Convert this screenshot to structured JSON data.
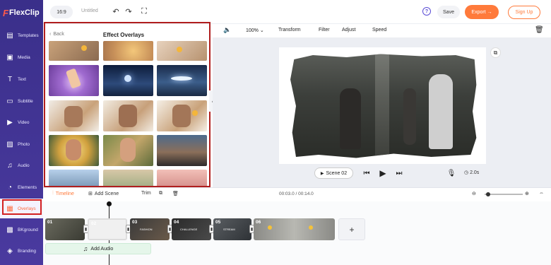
{
  "app": {
    "brand": "FlexClip",
    "brand_icon": "F"
  },
  "sidebar": {
    "items": [
      {
        "id": "templates",
        "label": "Templates",
        "icon": "templates-icon",
        "glyph": "▤"
      },
      {
        "id": "media",
        "label": "Media",
        "icon": "media-icon",
        "glyph": "▣"
      },
      {
        "id": "text",
        "label": "Text",
        "icon": "text-icon",
        "glyph": "T"
      },
      {
        "id": "subtitle",
        "label": "Subtitle",
        "icon": "subtitle-icon",
        "glyph": "▭"
      },
      {
        "id": "video",
        "label": "Video",
        "icon": "video-icon",
        "glyph": "▶"
      },
      {
        "id": "photo",
        "label": "Photo",
        "icon": "photo-icon",
        "glyph": "▨"
      },
      {
        "id": "audio",
        "label": "Audio",
        "icon": "audio-icon",
        "glyph": "♫"
      },
      {
        "id": "elements",
        "label": "Elements",
        "icon": "elements-icon",
        "glyph": "◔"
      },
      {
        "id": "overlays",
        "label": "Overlays",
        "icon": "overlays-icon",
        "glyph": "▦",
        "active": true
      },
      {
        "id": "bkground",
        "label": "BKground",
        "icon": "background-icon",
        "glyph": "▩"
      },
      {
        "id": "branding",
        "label": "Branding",
        "icon": "branding-icon",
        "glyph": "◈"
      }
    ]
  },
  "topbar": {
    "ratio": "16:9",
    "title": "Untitled",
    "save": "Save",
    "export": "Export →",
    "signup": "Sign Up",
    "help": "?"
  },
  "panel": {
    "back": "Back",
    "title": "Effect Overlays"
  },
  "canvas_toolbar": {
    "zoom": "100%",
    "transform": "Transform",
    "filter": "Filter",
    "adjust": "Adjust",
    "speed": "Speed"
  },
  "player": {
    "scene": "Scene 02",
    "duration": "2.0s"
  },
  "timeline": {
    "timeline_tab": "Timeline",
    "add_scene": "Add Scene",
    "trim": "Trim",
    "timecode": "00:03.0 / 00:14.0",
    "add_audio": "Add Audio",
    "clips": [
      {
        "num": "01",
        "caption": ""
      },
      {
        "num": "02",
        "caption": ""
      },
      {
        "num": "03",
        "caption": "FASHION"
      },
      {
        "num": "04",
        "caption": "CHALLENGE"
      },
      {
        "num": "05",
        "caption": "STREAM"
      },
      {
        "num": "06",
        "caption": ""
      }
    ]
  },
  "colors": {
    "accent": "#ff7a3b",
    "sidebar": "#3a2f8a",
    "highlight": "#b01e1e"
  }
}
